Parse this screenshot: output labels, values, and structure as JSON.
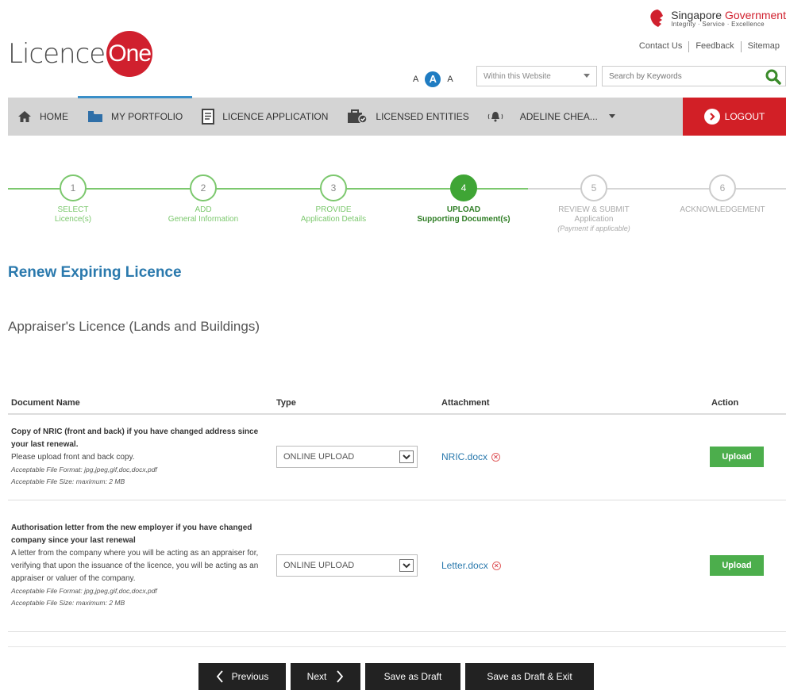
{
  "brand": {
    "logo_text": "Licence",
    "logo_highlight": "One"
  },
  "gov": {
    "title_part1": "Singapore",
    "title_part2": "Government",
    "motto": "Integrity · Service · Excellence"
  },
  "top_links": [
    "Contact Us",
    "Feedback",
    "Sitemap"
  ],
  "font_size": {
    "small": "A",
    "medium": "A",
    "large": "A"
  },
  "search": {
    "scope": "Within this Website",
    "placeholder": "Search by Keywords"
  },
  "nav": {
    "home": "HOME",
    "portfolio": "MY PORTFOLIO",
    "licence_application": "LICENCE APPLICATION",
    "licensed_entities": "LICENSED ENTITIES",
    "user": "ADELINE CHEA...",
    "logout": "LOGOUT"
  },
  "steps": [
    {
      "num": "1",
      "line1": "SELECT",
      "line2": "Licence(s)",
      "line3": ""
    },
    {
      "num": "2",
      "line1": "ADD",
      "line2": "General Information",
      "line3": ""
    },
    {
      "num": "3",
      "line1": "PROVIDE",
      "line2": "Application Details",
      "line3": ""
    },
    {
      "num": "4",
      "line1": "UPLOAD",
      "line2": "Supporting Document(s)",
      "line3": ""
    },
    {
      "num": "5",
      "line1": "REVIEW & SUBMIT",
      "line2": "Application",
      "line3": "(Payment if applicable)"
    },
    {
      "num": "6",
      "line1": "ACKNOWLEDGEMENT",
      "line2": "",
      "line3": ""
    }
  ],
  "page_title": "Renew Expiring Licence",
  "licence_name": "Appraiser's Licence (Lands and Buildings)",
  "table": {
    "headers": {
      "name": "Document Name",
      "type": "Type",
      "attachment": "Attachment",
      "action": "Action"
    },
    "rows": [
      {
        "name": "Copy of NRIC (front and back) if you have changed address since your last renewal.",
        "desc": "Please upload front and back copy.",
        "format": "Acceptable File Format: jpg,jpeg,gif,doc,docx,pdf",
        "size": "Acceptable File Size: maximum: 2 MB",
        "type": "ONLINE UPLOAD",
        "file": "NRIC.docx",
        "action": "Upload"
      },
      {
        "name": "Authorisation letter from the new employer if you have changed company since your last renewal",
        "desc": "A letter from the company where you will be acting as an appraiser for, verifying that upon the issuance of the licence, you will be acting as an appraiser or valuer of the company.",
        "format": "Acceptable File Format: jpg,jpeg,gif,doc,docx,pdf",
        "size": "Acceptable File Size: maximum: 2 MB",
        "type": "ONLINE UPLOAD",
        "file": "Letter.docx",
        "action": "Upload"
      }
    ]
  },
  "buttons": {
    "previous": "Previous",
    "next": "Next",
    "save_draft": "Save as Draft",
    "save_exit": "Save as Draft & Exit"
  },
  "colors": {
    "accent_blue": "#2a79ad",
    "step_green": "#3fa535",
    "logout_red": "#d21f26",
    "upload_green": "#4cae4c"
  }
}
